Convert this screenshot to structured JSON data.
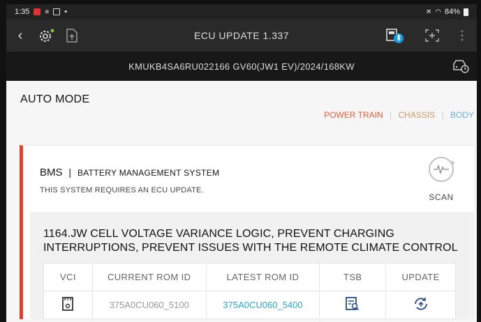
{
  "status_bar": {
    "time": "1:35",
    "battery": "84%"
  },
  "app_bar": {
    "back_glyph": "‹",
    "title": "ECU UPDATE 1.337"
  },
  "vehicle": {
    "info": "KMUKB4SA6RU022166  GV60(JW1 EV)/2024/168KW"
  },
  "page": {
    "title": "AUTO MODE"
  },
  "filters": {
    "power_train": "POWER TRAIN",
    "chassis": "CHASSIS",
    "body": "BODY",
    "separator": "|"
  },
  "system": {
    "code": "BMS",
    "separator": "|",
    "name": "BATTERY MANAGEMENT SYSTEM",
    "note": "THIS SYSTEM REQUIRES AN ECU UPDATE.",
    "scan_label": "SCAN"
  },
  "update": {
    "headline": "1164.JW CELL VOLTAGE VARIANCE LOGIC, PREVENT CHARGING INTERRUPTIONS, PREVENT ISSUES WITH THE REMOTE CLIMATE CONTROL",
    "columns": [
      "VCI",
      "CURRENT ROM ID",
      "LATEST ROM ID",
      "TSB",
      "UPDATE"
    ],
    "row": {
      "current_rom": "375A0CU060_5100",
      "latest_rom": "375A0CU060_5400"
    }
  },
  "icons": {
    "status": [
      "calendar-icon",
      "cast-icon",
      "document-icon",
      "mute-icon",
      "wifi-icon",
      "battery-icon"
    ],
    "appbar": [
      "back-icon",
      "diagnose-settings-icon",
      "upload-file-icon",
      "vci-bluetooth-icon",
      "add-frame-icon",
      "more-vertical-icon"
    ],
    "vin": "car-clock-icon",
    "card": [
      "scan-waveform-icon",
      "vci-device-icon",
      "tsb-document-search-icon",
      "update-sync-icon"
    ]
  },
  "colors": {
    "accent": "#e0412d",
    "power_train": "#e65a3a",
    "chassis": "#c69a6a",
    "body": "#6ab0d8",
    "link": "#2ba4c8",
    "bluetooth": "#1a9ad6"
  }
}
